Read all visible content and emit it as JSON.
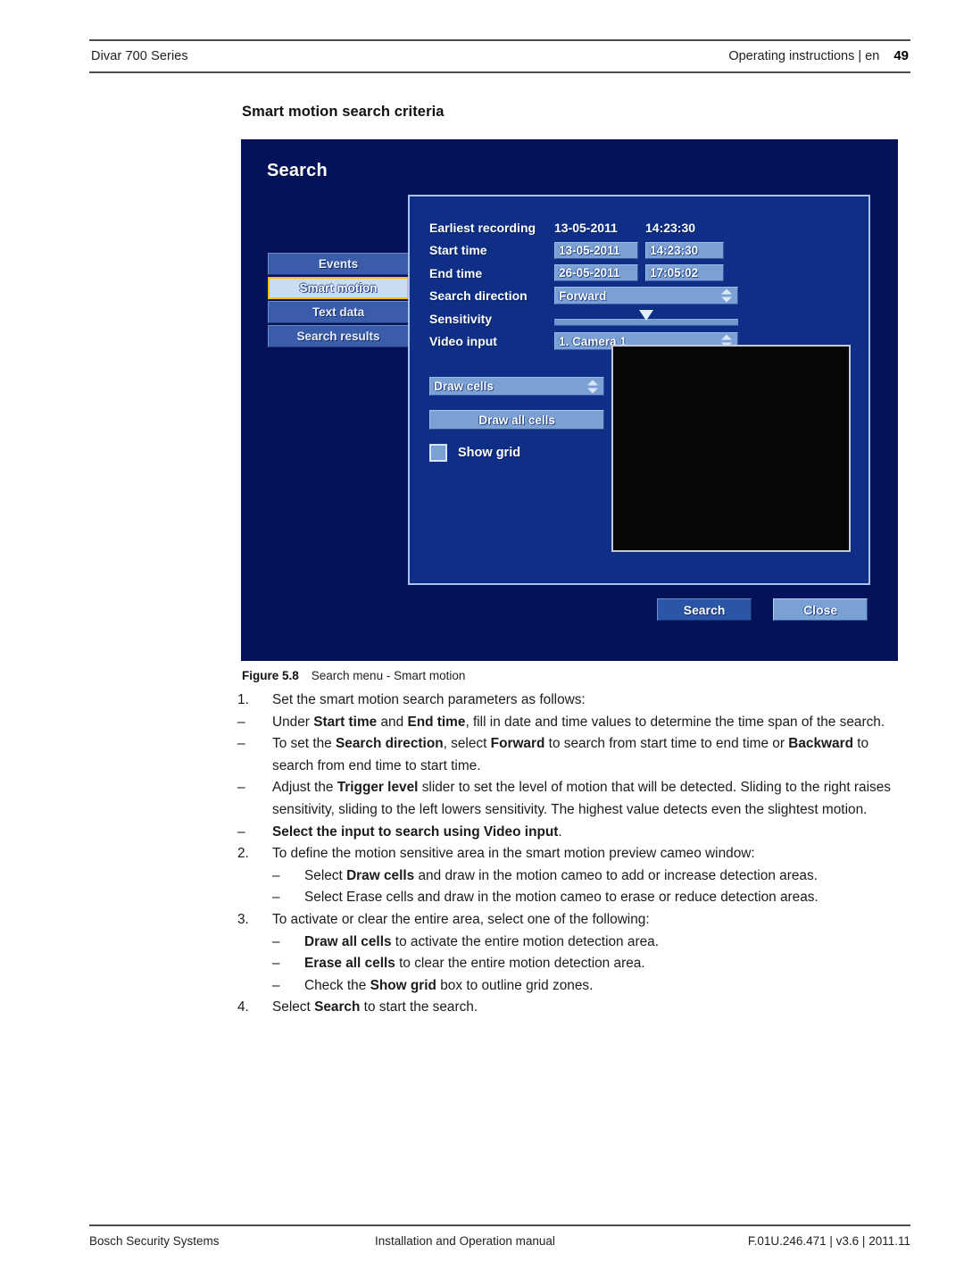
{
  "header": {
    "left": "Divar 700 Series",
    "right": "Operating instructions | en",
    "page_number": "49"
  },
  "section_title": "Smart motion search criteria",
  "figure": {
    "caption_label": "Figure 5.8",
    "caption_text": "Search menu - Smart motion",
    "screen": {
      "title": "Search",
      "tabs": [
        {
          "label": "Events",
          "selected": false
        },
        {
          "label": "Smart motion",
          "selected": true
        },
        {
          "label": "Text data",
          "selected": false
        },
        {
          "label": "Search results",
          "selected": false
        }
      ],
      "fields": {
        "earliest_recording_label": "Earliest recording",
        "earliest_recording_date": "13-05-2011",
        "earliest_recording_time": "14:23:30",
        "start_time_label": "Start time",
        "start_time_date": "13-05-2011",
        "start_time_time": "14:23:30",
        "end_time_label": "End time",
        "end_time_date": "26-05-2011",
        "end_time_time": "17:05:02",
        "search_direction_label": "Search direction",
        "search_direction_value": "Forward",
        "sensitivity_label": "Sensitivity",
        "video_input_label": "Video input",
        "video_input_value": "1. Camera 1"
      },
      "draw": {
        "mode_value": "Draw cells",
        "draw_all_label": "Draw all cells",
        "show_grid_label": "Show grid",
        "show_grid_checked": false
      },
      "buttons": {
        "search": "Search",
        "close": "Close"
      },
      "colors": {
        "background": "#041259",
        "dialog": "#0f2f86",
        "tab": "#3a5ca9",
        "tab_selected": "#c8dcf2",
        "tab_selected_border": "#ffc000",
        "field": "#7ba0d4",
        "cameo": "#060606"
      }
    }
  },
  "steps": [
    {
      "level": 1,
      "marker": "1.",
      "parts": [
        {
          "t": "Set the smart motion search parameters as follows:",
          "b": false
        }
      ]
    },
    {
      "level": 1,
      "marker": "–",
      "parts": [
        {
          "t": "Under ",
          "b": false
        },
        {
          "t": "Start time",
          "b": true
        },
        {
          "t": " and ",
          "b": false
        },
        {
          "t": "End time",
          "b": true
        },
        {
          "t": ", fill in date and time values to determine the time span of the search.",
          "b": false
        }
      ]
    },
    {
      "level": 1,
      "marker": "–",
      "parts": [
        {
          "t": "To set the ",
          "b": false
        },
        {
          "t": "Search direction",
          "b": true
        },
        {
          "t": ", select ",
          "b": false
        },
        {
          "t": "Forward",
          "b": true
        },
        {
          "t": " to search from start time to end time or ",
          "b": false
        },
        {
          "t": "Backward",
          "b": true
        },
        {
          "t": " to search from end time to start time.",
          "b": false
        }
      ]
    },
    {
      "level": 1,
      "marker": "–",
      "parts": [
        {
          "t": "Adjust the ",
          "b": false
        },
        {
          "t": "Trigger level",
          "b": true
        },
        {
          "t": " slider to set the level of motion that will be detected. Sliding to the right raises sensitivity, sliding to the left lowers sensitivity. The highest value detects even the slightest motion.",
          "b": false
        }
      ]
    },
    {
      "level": 1,
      "marker": "–",
      "parts": [
        {
          "t": "Select the input to search using Video input",
          "b": true
        },
        {
          "t": ".",
          "b": false
        }
      ]
    },
    {
      "level": 1,
      "marker": "2.",
      "parts": [
        {
          "t": "To define the motion sensitive area in the smart motion preview cameo window:",
          "b": false
        }
      ]
    },
    {
      "level": 2,
      "marker": "–",
      "parts": [
        {
          "t": "Select ",
          "b": false
        },
        {
          "t": "Draw cells",
          "b": true
        },
        {
          "t": " and draw in the motion cameo to add or increase detection areas.",
          "b": false
        }
      ]
    },
    {
      "level": 2,
      "marker": "–",
      "parts": [
        {
          "t": "Select Erase cells and draw in the motion cameo to erase or reduce detection areas.",
          "b": false
        }
      ]
    },
    {
      "level": 1,
      "marker": "3.",
      "parts": [
        {
          "t": "To activate or clear the entire area, select one of the following:",
          "b": false
        }
      ]
    },
    {
      "level": 2,
      "marker": "–",
      "parts": [
        {
          "t": "Draw all cells",
          "b": true
        },
        {
          "t": " to activate the entire motion detection area.",
          "b": false
        }
      ]
    },
    {
      "level": 2,
      "marker": "–",
      "parts": [
        {
          "t": "Erase all cells",
          "b": true
        },
        {
          "t": " to clear the entire motion detection area.",
          "b": false
        }
      ]
    },
    {
      "level": 2,
      "marker": "–",
      "parts": [
        {
          "t": "Check the ",
          "b": false
        },
        {
          "t": "Show grid",
          "b": true
        },
        {
          "t": " box to outline grid zones.",
          "b": false
        }
      ]
    },
    {
      "level": 1,
      "marker": "4.",
      "parts": [
        {
          "t": "Select ",
          "b": false
        },
        {
          "t": "Search",
          "b": true
        },
        {
          "t": " to start the search.",
          "b": false
        }
      ]
    }
  ],
  "footer": {
    "left": "Bosch Security Systems",
    "middle": "Installation and Operation manual",
    "right": "F.01U.246.471 | v3.6 | 2011.11"
  }
}
